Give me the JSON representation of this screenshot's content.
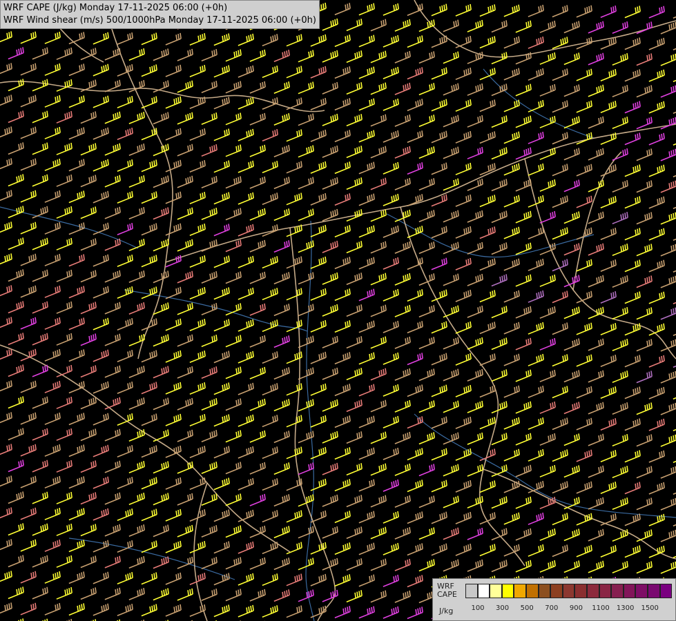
{
  "header": {
    "line1": "WRF CAPE (J/kg) Monday 17-11-2025 06:00 (+0h)",
    "line2": "WRF Wind shear (m/s) 500/1000hPa Monday 17-11-2025 06:00 (+0h)"
  },
  "legend": {
    "title_line1": "WRF",
    "title_line2": "CAPE",
    "unit": "J/kg",
    "swatch_colors": [
      "#c8c8c8",
      "#ffffff",
      "#ffff99",
      "#ffff00",
      "#f0a800",
      "#c07000",
      "#8c4f1f",
      "#8c3f20",
      "#8c3830",
      "#8a2f30",
      "#8c2a3c",
      "#8a2545",
      "#861f50",
      "#82155a",
      "#7e0e66",
      "#7a0870",
      "#7a0080"
    ],
    "tick_labels": [
      "100",
      "300",
      "500",
      "700",
      "900",
      "1100",
      "1300",
      "1500"
    ]
  },
  "map": {
    "barb_colors": {
      "yellow": "#ffff33",
      "tan": "#c8a070",
      "salmon": "#e87c78",
      "magenta": "#e040e0",
      "violet": "#b070c0"
    },
    "border_color": "#e8c8a0",
    "river_color": "#3a6aa0"
  }
}
